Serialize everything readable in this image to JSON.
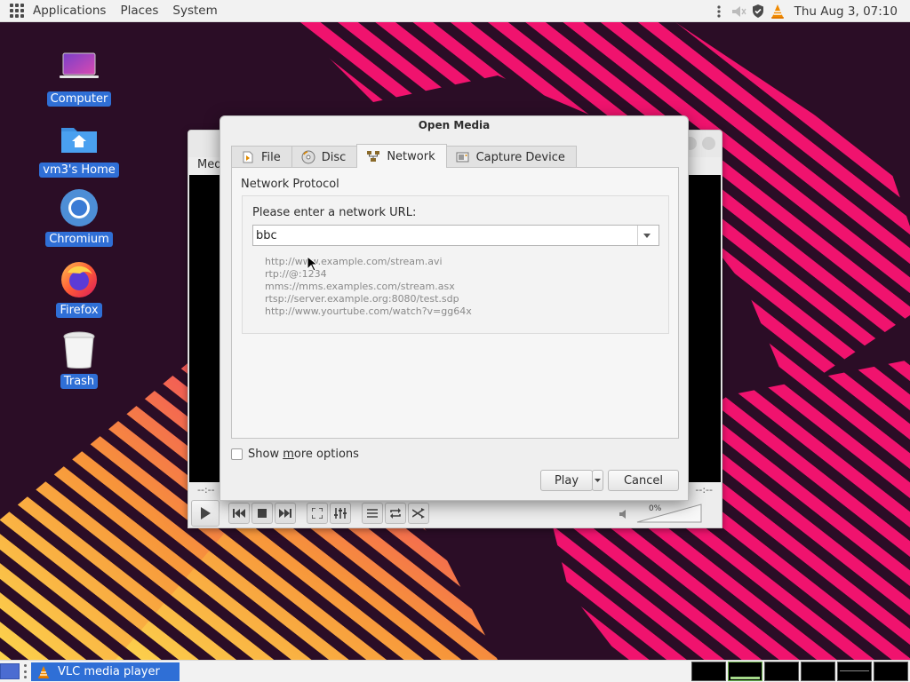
{
  "top_panel": {
    "applications": "Applications",
    "places": "Places",
    "system": "System",
    "clock": "Thu Aug  3, 07:10",
    "tray_icons": [
      "menu-dots-icon",
      "volume-muted-icon",
      "shield-icon",
      "vlc-cone-icon"
    ]
  },
  "desktop_icons": [
    {
      "label": "Computer",
      "icon": "laptop-icon"
    },
    {
      "label": "vm3's Home",
      "icon": "home-folder-icon"
    },
    {
      "label": "Chromium",
      "icon": "chromium-icon"
    },
    {
      "label": "Firefox",
      "icon": "firefox-icon"
    },
    {
      "label": "Trash",
      "icon": "trash-icon"
    }
  ],
  "vlc": {
    "menu_partial": "Med",
    "time_elapsed": "--:--",
    "time_total": "--:--",
    "volume": "0%"
  },
  "dialog": {
    "title": "Open Media",
    "tabs": [
      {
        "label": "File",
        "icon": "file-icon",
        "active": false
      },
      {
        "label": "Disc",
        "icon": "disc-icon",
        "active": false
      },
      {
        "label": "Network",
        "icon": "network-icon",
        "active": true
      },
      {
        "label": "Capture Device",
        "icon": "capture-icon",
        "active": false
      }
    ],
    "group_title": "Network Protocol",
    "url_label": "Please enter a network URL:",
    "url_value": "bbc",
    "examples": [
      "http://www.example.com/stream.avi",
      "rtp://@:1234",
      "mms://mms.examples.com/stream.asx",
      "rtsp://server.example.org:8080/test.sdp",
      "http://www.yourtube.com/watch?v=gg64x"
    ],
    "show_more_label_pre": "Show ",
    "show_more_label_ul": "m",
    "show_more_label_post": "ore options",
    "show_more_checked": false,
    "play_label": "Play",
    "cancel_label": "Cancel"
  },
  "taskbar": {
    "vlc_task_label": "VLC media player"
  },
  "colors": {
    "accent": "#2f6fd6",
    "wallpaper_bg": "#2b0d26",
    "stripe_pink": "#f0136e",
    "stripe_orange": "#f7953a"
  }
}
